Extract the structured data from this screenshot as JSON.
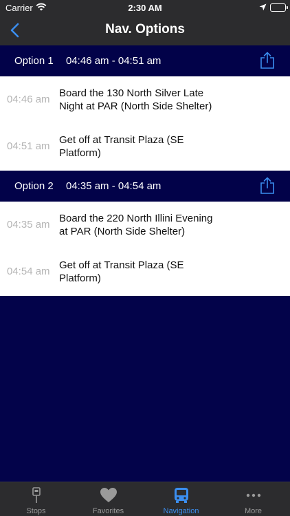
{
  "status_bar": {
    "carrier": "Carrier",
    "time": "2:30 AM"
  },
  "nav": {
    "title": "Nav. Options",
    "back_icon": "chevron-left-icon"
  },
  "options": [
    {
      "label": "Option 1",
      "time_range": "04:46 am - 04:51 am",
      "steps": [
        {
          "time": "04:46 am",
          "text": "Board the 130 North Silver Late Night at PAR (North Side Shelter)"
        },
        {
          "time": "04:51 am",
          "text": "Get off at Transit Plaza (SE Platform)"
        }
      ]
    },
    {
      "label": "Option 2",
      "time_range": "04:35 am - 04:54 am",
      "steps": [
        {
          "time": "04:35 am",
          "text": "Board the 220 North Illini Evening at PAR (North Side Shelter)"
        },
        {
          "time": "04:54 am",
          "text": "Get off at Transit Plaza (SE Platform)"
        }
      ]
    }
  ],
  "tabs": [
    {
      "label": "Stops",
      "icon": "bus-stop-icon"
    },
    {
      "label": "Favorites",
      "icon": "heart-icon"
    },
    {
      "label": "Navigation",
      "icon": "bus-icon",
      "active": true
    },
    {
      "label": "More",
      "icon": "more-dots-icon"
    }
  ],
  "colors": {
    "background": "#03034a",
    "header": "#020249",
    "bar": "#2c2c2e",
    "accent": "#3b8ef0",
    "time_gray": "#b5b5b5"
  }
}
